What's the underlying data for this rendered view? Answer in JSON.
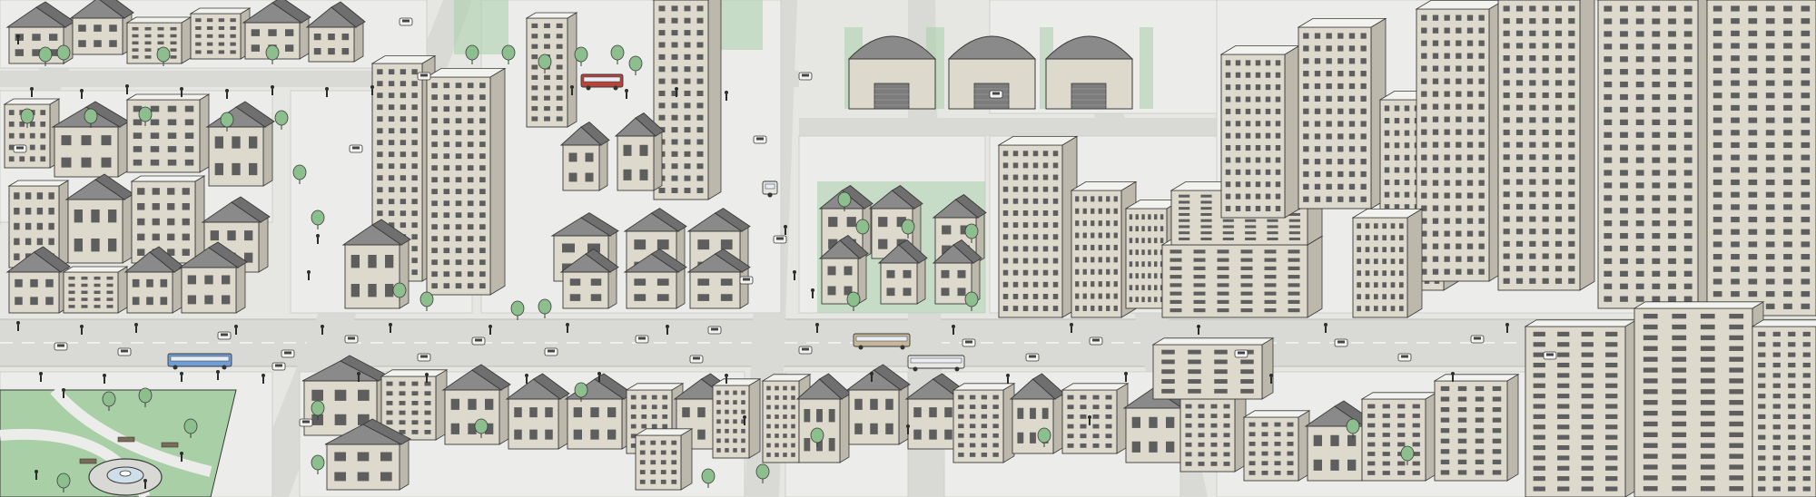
{
  "scene": {
    "kind": "isometric-city-illustration",
    "elements": [
      "city-blocks",
      "streets",
      "park",
      "fountain",
      "warehouses",
      "houses",
      "apartment-towers",
      "skyscrapers",
      "buses",
      "cars",
      "pedestrians",
      "trees"
    ]
  },
  "palette": {
    "background": "#e6e6e2",
    "road": "#d9d9d5",
    "sidewalk": "#ececea",
    "roof": "#8a8a8a",
    "roof_dark": "#6f6f6f",
    "wall": "#ddd9cc",
    "wall_shade": "#bcb8ab",
    "window": "#5e5e5e",
    "grass": "#a9cfa7",
    "tree": "#8dbf8e",
    "outline": "#3a3a3a",
    "bus_blue": "#6f9ed6"
  }
}
